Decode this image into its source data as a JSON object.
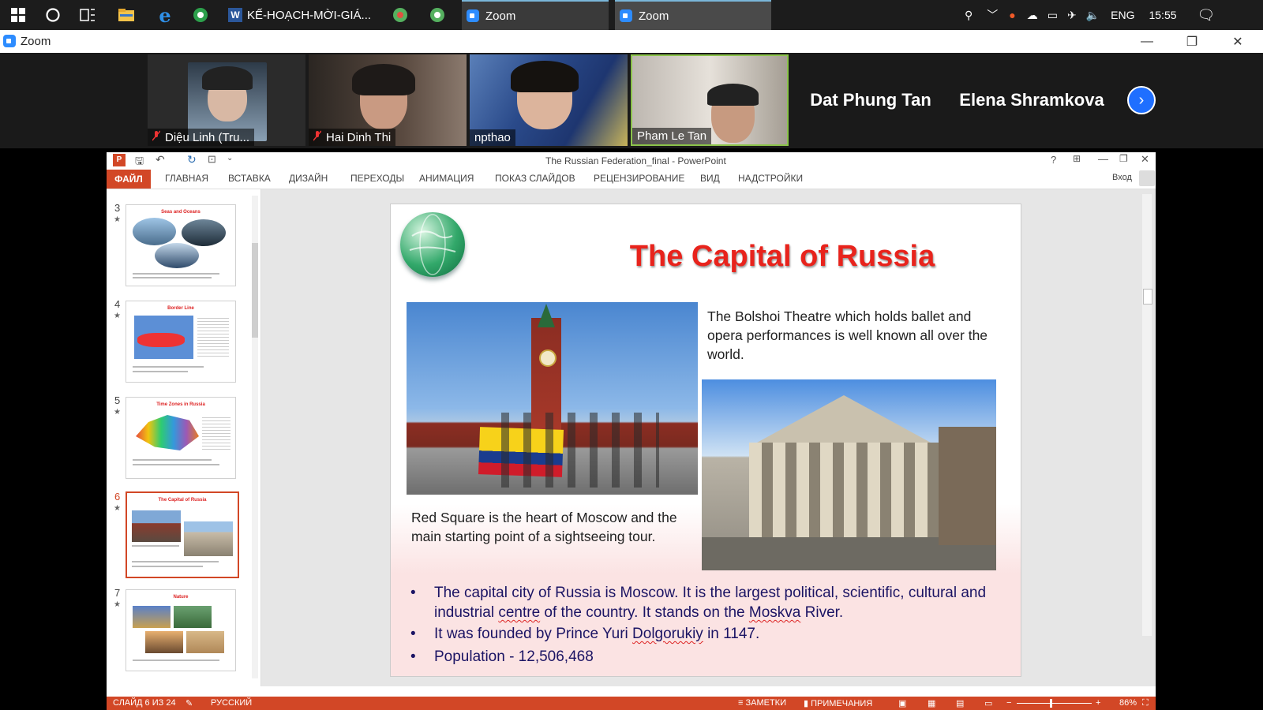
{
  "taskbar": {
    "apps": [
      {
        "label": "KẾ-HOẠCH-MỜI-GIÁ..."
      },
      {
        "label": "Zoom"
      },
      {
        "label": "Zoom"
      }
    ],
    "language": "ENG",
    "time": "15:55"
  },
  "zoom": {
    "window_title": "Zoom",
    "participants": [
      {
        "name": "Diệu Linh (Tru...",
        "muted": true
      },
      {
        "name": "Hai Dinh Thi",
        "muted": true
      },
      {
        "name": "npthao",
        "muted": false
      },
      {
        "name": "Pham Le Tan",
        "muted": false,
        "active_speaker": true
      }
    ],
    "name_only_tiles": [
      "Dat Phung Tan",
      "Elena Shramkova"
    ]
  },
  "powerpoint": {
    "title": "The Russian Federation_final - PowerPoint",
    "signin": "Вход",
    "ribbon_tabs": [
      "ФАЙЛ",
      "ГЛАВНАЯ",
      "ВСТАВКА",
      "ДИЗАЙН",
      "ПЕРЕХОДЫ",
      "АНИМАЦИЯ",
      "ПОКАЗ СЛАЙДОВ",
      "РЕЦЕНЗИРОВАНИЕ",
      "ВИД",
      "НАДСТРОЙКИ"
    ],
    "thumbnails": [
      {
        "number": "3",
        "title": "Seas and Oceans"
      },
      {
        "number": "4",
        "title": "Border Line"
      },
      {
        "number": "5",
        "title": "Time Zones in Russia"
      },
      {
        "number": "6",
        "title": "The Capital of Russia",
        "selected": true
      },
      {
        "number": "7",
        "title": "Nature"
      }
    ],
    "slide": {
      "title": "The Capital of Russia",
      "bolshoi_text": "The Bolshoi Theatre which holds ballet and opera performances is well known all over the world.",
      "redsquare_text": "Red Square is the heart of Moscow and  the main starting point of a sightseeing tour.",
      "bullets": {
        "b1_part1": "The capital city of Russia is Moscow. It is the largest political, scientific, cultural and industrial ",
        "b1_centre": "centre",
        "b1_part2": " of the country. It stands on the ",
        "b1_moskva": "Moskva",
        "b1_part3": " River.",
        "b2_part1": "It was founded by Prince Yuri ",
        "b2_dolgorukiy": "Dolgorukiy",
        "b2_part2": " in 1147.",
        "b3": "Population - 12,506,468"
      }
    },
    "status": {
      "slide_counter": "СЛАЙД 6 ИЗ 24",
      "language": "РУССКИЙ",
      "notes": "ЗАМЕТКИ",
      "comments": "ПРИМЕЧАНИЯ",
      "zoom": "86%"
    }
  },
  "colors": {
    "ppt_accent": "#d24726",
    "slide_title": "#e8231c",
    "bullet_text": "#1b1464",
    "zoom_blue": "#2d8cff"
  }
}
